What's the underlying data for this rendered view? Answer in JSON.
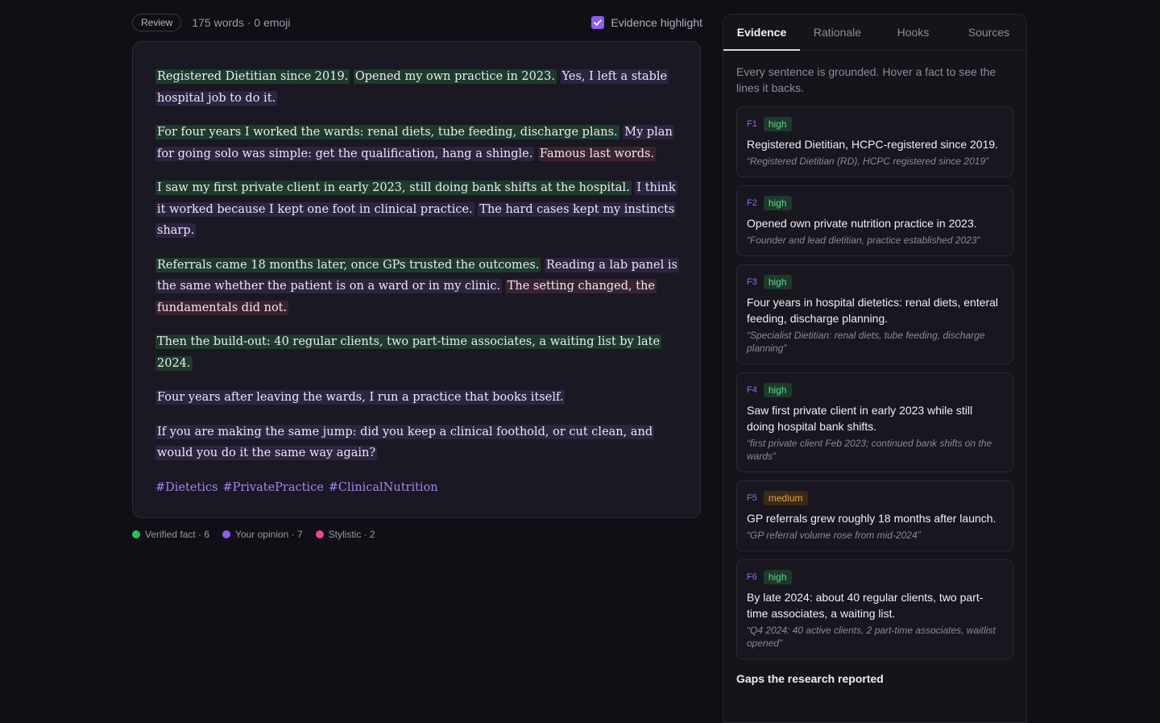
{
  "toolbar": {
    "mode_pill": "Review",
    "word_count": "175 words · 0 emoji",
    "evidence_toggle_label": "Evidence highlight",
    "evidence_toggle_checked": true
  },
  "draft": {
    "paragraphs": [
      [
        {
          "type": "fact",
          "text": "Registered Dietitian since 2019."
        },
        {
          "type": "fact",
          "text": "Opened my own practice in 2023."
        },
        {
          "type": "opinion",
          "text": "Yes, I left a stable hospital job to do it."
        }
      ],
      [
        {
          "type": "fact",
          "text": "For four years I worked the wards: renal diets, tube feeding, discharge plans."
        },
        {
          "type": "opinion",
          "text": "My plan for going solo was simple: get the qualification, hang a shingle."
        },
        {
          "type": "stylistic",
          "text": "Famous last words."
        }
      ],
      [
        {
          "type": "fact",
          "text": "I saw my first private client in early 2023, still doing bank shifts at the hospital."
        },
        {
          "type": "opinion",
          "text": "I think it worked because I kept one foot in clinical practice."
        },
        {
          "type": "opinion",
          "text": "The hard cases kept my instincts sharp."
        }
      ],
      [
        {
          "type": "fact",
          "text": "Referrals came 18 months later, once GPs trusted the outcomes."
        },
        {
          "type": "opinion",
          "text": "Reading a lab panel is the same whether the patient is on a ward or in my clinic."
        },
        {
          "type": "stylistic",
          "text": "The setting changed, the fundamentals did not."
        }
      ],
      [
        {
          "type": "fact",
          "text": "Then the build-out: 40 regular clients, two part-time associates, a waiting list by late 2024."
        }
      ],
      [
        {
          "type": "opinion",
          "text": "Four years after leaving the wards, I run a practice that books itself."
        }
      ],
      [
        {
          "type": "opinion",
          "text": "If you are making the same jump: did you keep a clinical foothold, or cut clean, and would you do it the same way again?"
        }
      ]
    ],
    "hashtags": [
      "#Dietetics",
      "#PrivatePractice",
      "#ClinicalNutrition"
    ]
  },
  "legend": [
    {
      "label": "Verified fact · 6",
      "color": "#22c55e"
    },
    {
      "label": "Your opinion · 7",
      "color": "#8b5cf6"
    },
    {
      "label": "Stylistic · 2",
      "color": "#ec4899"
    }
  ],
  "panel": {
    "tabs": [
      "Evidence",
      "Rationale",
      "Hooks",
      "Sources"
    ],
    "active_tab": "Evidence",
    "intro": "Every sentence is grounded. Hover a fact to see the lines it backs.",
    "facts": [
      {
        "id": "F1",
        "confidence": "high",
        "claim": "Registered Dietitian, HCPC-registered since 2019.",
        "quote": "“Registered Dietitian (RD), HCPC registered since 2019”"
      },
      {
        "id": "F2",
        "confidence": "high",
        "claim": "Opened own private nutrition practice in 2023.",
        "quote": "“Founder and lead dietitian, practice established 2023”"
      },
      {
        "id": "F3",
        "confidence": "high",
        "claim": "Four years in hospital dietetics: renal diets, enteral feeding, discharge planning.",
        "quote": "“Specialist Dietitian: renal diets, tube feeding, discharge planning”"
      },
      {
        "id": "F4",
        "confidence": "high",
        "claim": "Saw first private client in early 2023 while still doing hospital bank shifts.",
        "quote": "“first private client Feb 2023; continued bank shifts on the wards”"
      },
      {
        "id": "F5",
        "confidence": "medium",
        "claim": "GP referrals grew roughly 18 months after launch.",
        "quote": "“GP referral volume rose from mid-2024”"
      },
      {
        "id": "F6",
        "confidence": "high",
        "claim": "By late 2024: about 40 regular clients, two part-time associates, a waiting list.",
        "quote": "“Q4 2024: 40 active clients, 2 part-time associates, waitlist opened”"
      }
    ],
    "next_section_heading": "Gaps the research reported"
  }
}
